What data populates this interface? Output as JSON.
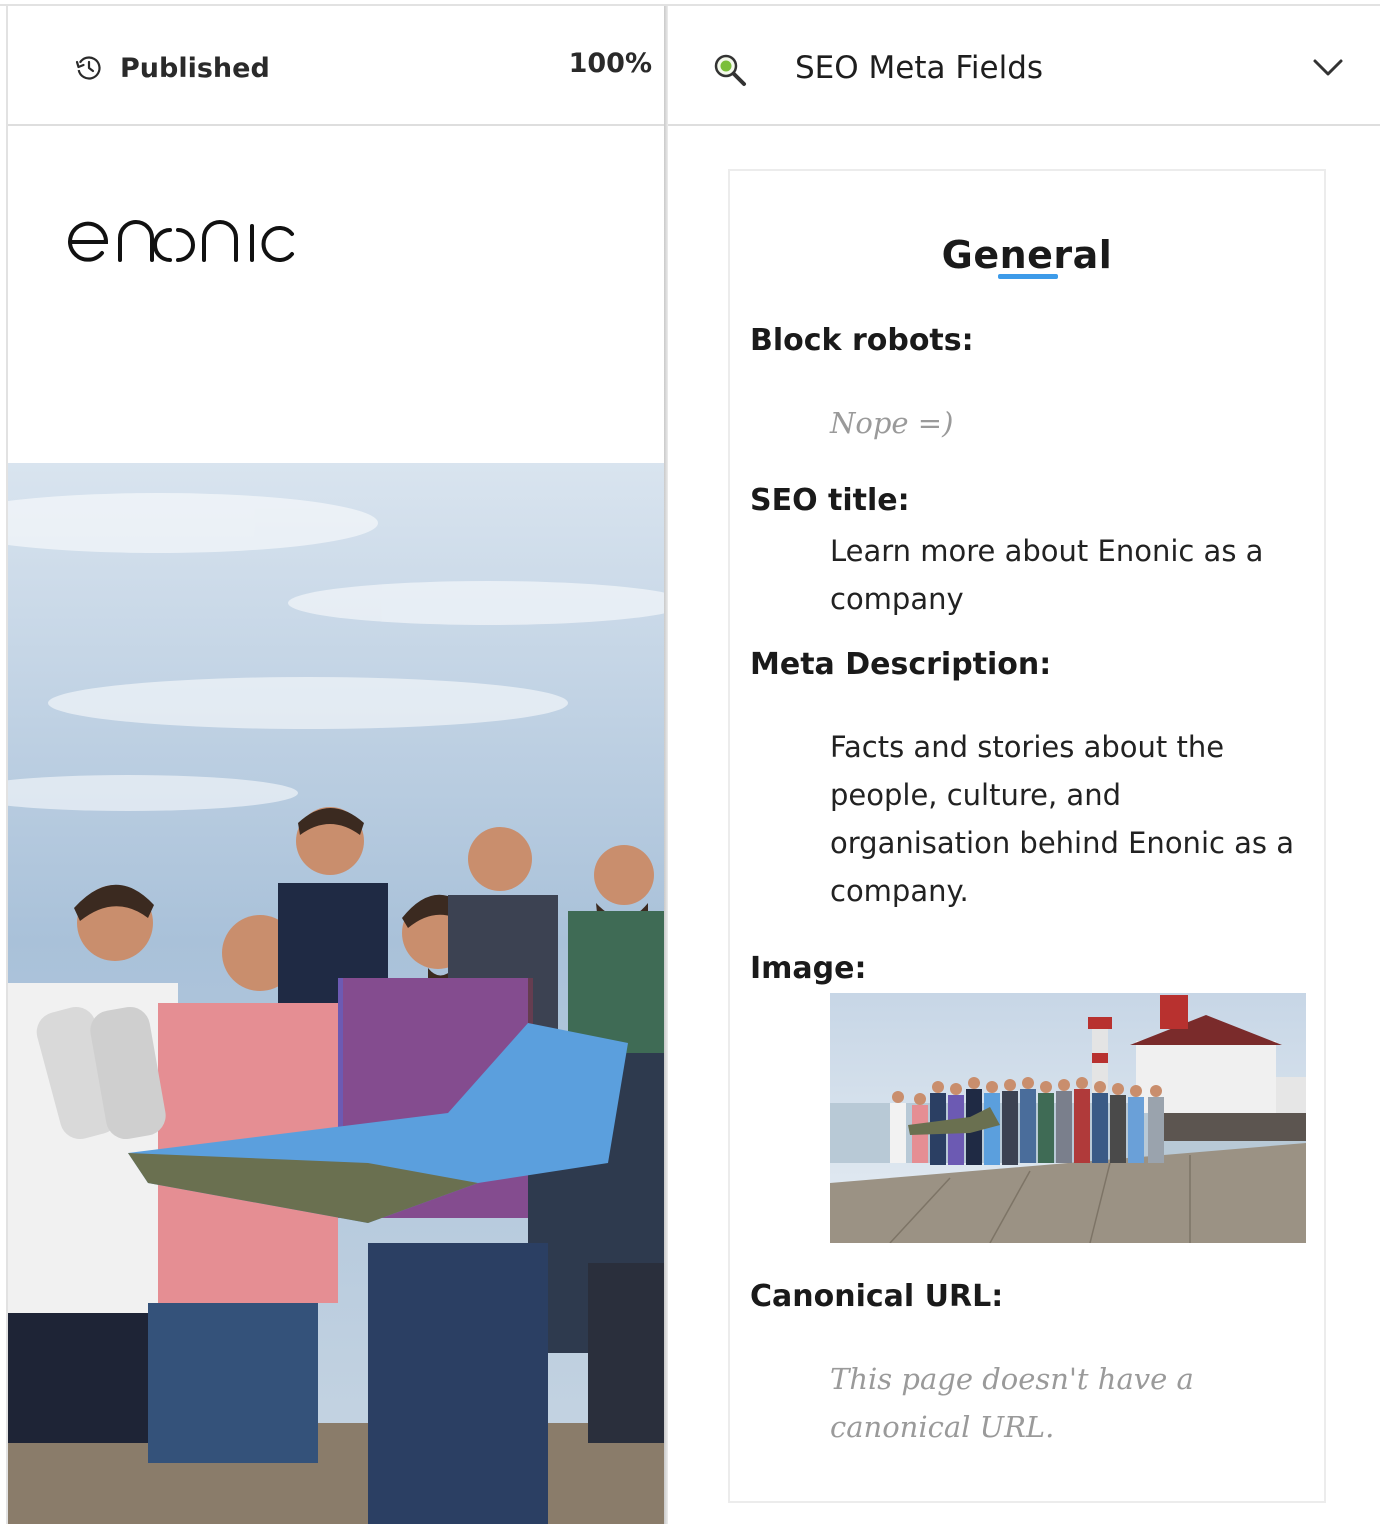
{
  "preview": {
    "status_label": "Published",
    "zoom": "100%",
    "logo_alt": "enonic",
    "hero_image": "team-photo"
  },
  "seo_panel": {
    "title": "SEO Meta Fields",
    "icon": "seo-magnifier-icon",
    "toggle_icon": "chevron-down-icon",
    "section_heading": "General",
    "fields": {
      "block_robots": {
        "label": "Block robots:",
        "value": "Nope =)"
      },
      "seo_title": {
        "label": "SEO title:",
        "value": "Learn more about Enonic as a company"
      },
      "meta_description": {
        "label": "Meta Description:",
        "value": "Facts and stories about the people, culture, and organisation behind Enonic as a company."
      },
      "image": {
        "label": "Image:",
        "value": "team-lighthouse-photo"
      },
      "canonical_url": {
        "label": "Canonical URL:",
        "value": "This page doesn't have a canonical URL."
      }
    }
  },
  "colors": {
    "accent": "#3d9be9",
    "muted_text": "#9a9a9a",
    "border": "#dedede"
  }
}
